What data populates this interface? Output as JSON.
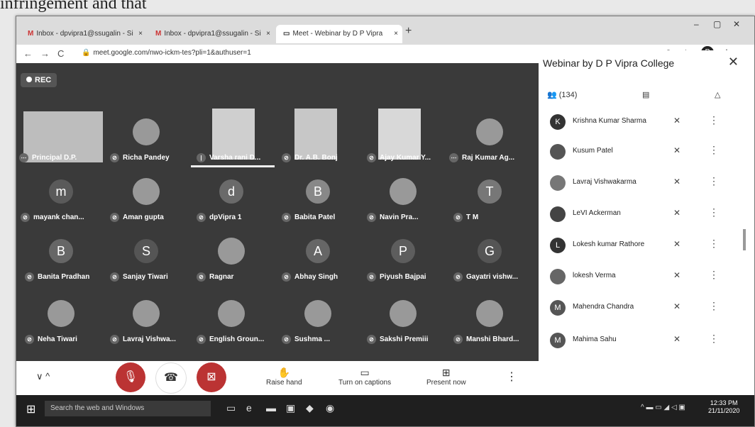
{
  "top_text": "infringement and that",
  "browser": {
    "tabs": [
      {
        "label": "Inbox - dpvipra1@ssugalin - Si",
        "icon": "gmail-icon"
      },
      {
        "label": "Inbox - dpvipra1@ssugalin - Si",
        "icon": "gmail-icon"
      },
      {
        "label": "Meet - Webinar by D P Vipra",
        "icon": "meet-icon"
      }
    ],
    "url": "meet.google.com/nwo-ickm-tes?pli=1&authuser=1",
    "profile_initial": "P"
  },
  "meet": {
    "rec_label": "REC",
    "participants": [
      {
        "name": "Principal D.P.",
        "kind": "video"
      },
      {
        "name": "Richa Pandey",
        "kind": "photo"
      },
      {
        "name": "Varsha rani D...",
        "kind": "video"
      },
      {
        "name": "Dr. A.B. Bonj",
        "kind": "video"
      },
      {
        "name": "Ajay Kumar Y...",
        "kind": "video"
      },
      {
        "name": "Raj Kumar Ag...",
        "kind": "photo"
      },
      {
        "name": "mayank chan...",
        "kind": "letter",
        "initial": "m"
      },
      {
        "name": "Aman gupta",
        "kind": "photo"
      },
      {
        "name": "dpVipra 1",
        "kind": "letter",
        "initial": "d"
      },
      {
        "name": "Babita Patel",
        "kind": "letter",
        "initial": "B"
      },
      {
        "name": "Navin Pra...",
        "kind": "photo"
      },
      {
        "name": "T M",
        "kind": "letter",
        "initial": "T"
      },
      {
        "name": "Banita Pradhan",
        "kind": "letter",
        "initial": "B"
      },
      {
        "name": "Sanjay Tiwari",
        "kind": "letter",
        "initial": "S"
      },
      {
        "name": "Ragnar",
        "kind": "photo"
      },
      {
        "name": "Abhay Singh",
        "kind": "letter",
        "initial": "A"
      },
      {
        "name": "Piyush Bajpai",
        "kind": "letter",
        "initial": "P"
      },
      {
        "name": "Gayatri vishw...",
        "kind": "letter",
        "initial": "G"
      },
      {
        "name": "Neha Tiwari",
        "kind": "photo"
      },
      {
        "name": "Lavraj Vishwa...",
        "kind": "photo"
      },
      {
        "name": "English Groun...",
        "kind": "photo"
      },
      {
        "name": "Sushma ...",
        "kind": "photo"
      },
      {
        "name": "Sakshi Premiii",
        "kind": "photo"
      },
      {
        "name": "Manshi Bhard...",
        "kind": "photo"
      }
    ]
  },
  "controls": {
    "raise_hand": "Raise hand",
    "captions": "Turn on captions",
    "present": "Present now"
  },
  "panel": {
    "title": "Webinar by D P Vipra College",
    "people_count": "(134)",
    "people": [
      {
        "name": "Krishna Kumar Sharma",
        "initial": "K"
      },
      {
        "name": "Kusum Patel",
        "initial": ""
      },
      {
        "name": "Lavraj Vishwakarma",
        "initial": ""
      },
      {
        "name": "LeVI Ackerman",
        "initial": ""
      },
      {
        "name": "Lokesh kumar Rathore",
        "initial": "L"
      },
      {
        "name": "lokesh Verma",
        "initial": ""
      },
      {
        "name": "Mahendra Chandra",
        "initial": "M"
      },
      {
        "name": "Mahima Sahu",
        "initial": "M"
      }
    ]
  },
  "taskbar": {
    "search_placeholder": "Search the web and Windows",
    "time": "12:33 PM",
    "date": "21/11/2020"
  }
}
